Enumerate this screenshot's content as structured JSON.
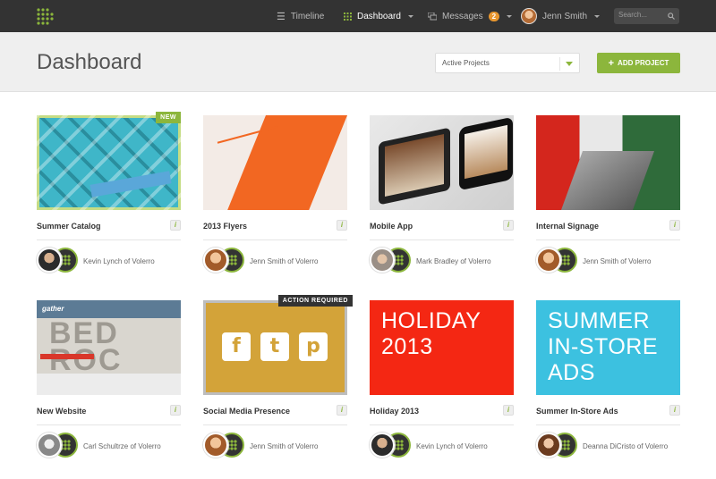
{
  "nav": {
    "items": [
      {
        "label": "Timeline",
        "icon": "list-icon"
      },
      {
        "label": "Dashboard",
        "icon": "grid-icon"
      },
      {
        "label": "Messages",
        "icon": "chat-icon",
        "badge": "2"
      }
    ],
    "user": "Jenn Smith",
    "search_placeholder": "Search..."
  },
  "header": {
    "title": "Dashboard",
    "filter_value": "Active Projects",
    "add_label": "ADD PROJECT"
  },
  "colors": {
    "accent": "#8cb63c",
    "topbar": "#333333",
    "holiday": "#f42713",
    "ads": "#3cc1e0"
  },
  "projects": [
    {
      "title": "Summer Catalog",
      "owner": "Kevin Lynch of Volerro",
      "ribbon": "NEW"
    },
    {
      "title": "2013 Flyers",
      "owner": "Jenn Smith of Volerro"
    },
    {
      "title": "Mobile App",
      "owner": "Mark Bradley of Volerro"
    },
    {
      "title": "Internal Signage",
      "owner": "Jenn Smith of Volerro"
    },
    {
      "title": "New Website",
      "owner": "Carl Schultrze of Volerro",
      "thumb_text": {
        "logo": "gather",
        "big": "BED\nROC"
      }
    },
    {
      "title": "Social Media Presence",
      "owner": "Jenn Smith of Volerro",
      "ribbon": "ACTION REQUIRED",
      "thumb_icons": [
        "f",
        "t",
        "p"
      ]
    },
    {
      "title": "Holiday 2013",
      "owner": "Kevin Lynch of Volerro",
      "thumb_text": {
        "big": "HOLIDAY\n2013"
      }
    },
    {
      "title": "Summer In-Store Ads",
      "owner": "Deanna DiCristo of Volerro",
      "thumb_text": {
        "big": "SUMMER\nIN-STORE\nADS"
      }
    }
  ]
}
